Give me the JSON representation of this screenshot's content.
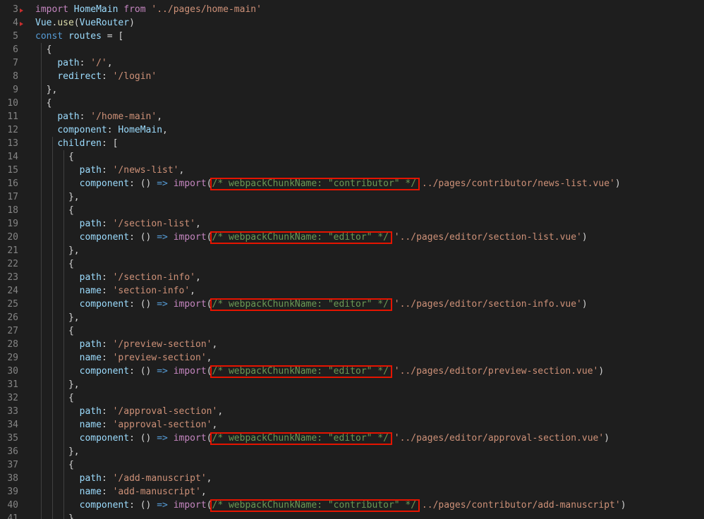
{
  "editor": {
    "lines": [
      {
        "n": "3",
        "toks": [
          [
            "ctrl",
            "import"
          ],
          [
            "punc",
            " "
          ],
          [
            "var",
            "HomeMain"
          ],
          [
            "punc",
            " "
          ],
          [
            "ctrl",
            "from"
          ],
          [
            "punc",
            " "
          ],
          [
            "str",
            "'../pages/home-main'"
          ]
        ]
      },
      {
        "n": "4",
        "toks": [
          [
            "var",
            "Vue"
          ],
          [
            "punc",
            "."
          ],
          [
            "fn",
            "use"
          ],
          [
            "punc",
            "("
          ],
          [
            "var",
            "VueRouter"
          ],
          [
            "punc",
            ")"
          ]
        ]
      },
      {
        "n": "5",
        "toks": [
          [
            "kw",
            "const"
          ],
          [
            "punc",
            " "
          ],
          [
            "var",
            "routes"
          ],
          [
            "punc",
            " = ["
          ]
        ]
      },
      {
        "n": "6",
        "toks": [
          [
            "punc",
            "  {"
          ]
        ]
      },
      {
        "n": "7",
        "toks": [
          [
            "punc",
            "    "
          ],
          [
            "var",
            "path"
          ],
          [
            "punc",
            ": "
          ],
          [
            "str",
            "'/'"
          ],
          [
            "punc",
            ","
          ]
        ]
      },
      {
        "n": "8",
        "toks": [
          [
            "punc",
            "    "
          ],
          [
            "var",
            "redirect"
          ],
          [
            "punc",
            ": "
          ],
          [
            "str",
            "'/login'"
          ]
        ]
      },
      {
        "n": "9",
        "toks": [
          [
            "punc",
            "  },"
          ]
        ]
      },
      {
        "n": "10",
        "toks": [
          [
            "punc",
            "  {"
          ]
        ]
      },
      {
        "n": "11",
        "toks": [
          [
            "punc",
            "    "
          ],
          [
            "var",
            "path"
          ],
          [
            "punc",
            ": "
          ],
          [
            "str",
            "'/home-main'"
          ],
          [
            "punc",
            ","
          ]
        ]
      },
      {
        "n": "12",
        "toks": [
          [
            "punc",
            "    "
          ],
          [
            "var",
            "component"
          ],
          [
            "punc",
            ": "
          ],
          [
            "var",
            "HomeMain"
          ],
          [
            "punc",
            ","
          ]
        ]
      },
      {
        "n": "13",
        "toks": [
          [
            "punc",
            "    "
          ],
          [
            "var",
            "children"
          ],
          [
            "punc",
            ": ["
          ]
        ]
      },
      {
        "n": "14",
        "toks": [
          [
            "punc",
            "      {"
          ]
        ]
      },
      {
        "n": "15",
        "toks": [
          [
            "punc",
            "        "
          ],
          [
            "var",
            "path"
          ],
          [
            "punc",
            ": "
          ],
          [
            "str",
            "'/news-list'"
          ],
          [
            "punc",
            ","
          ]
        ]
      },
      {
        "n": "16",
        "toks": [
          [
            "punc",
            "        "
          ],
          [
            "var",
            "component"
          ],
          [
            "punc",
            ": () "
          ],
          [
            "kw",
            "=>"
          ],
          [
            "punc",
            " "
          ],
          [
            "ctrl",
            "import"
          ],
          [
            "punc",
            "("
          ],
          [
            "cmt",
            "/* webpackChunkName: \"contributor\" */"
          ],
          [
            "str",
            "'../pages/contributor/news-list.vue'"
          ],
          [
            "punc",
            ")"
          ]
        ]
      },
      {
        "n": "17",
        "toks": [
          [
            "punc",
            "      },"
          ]
        ]
      },
      {
        "n": "18",
        "toks": [
          [
            "punc",
            "      {"
          ]
        ]
      },
      {
        "n": "19",
        "toks": [
          [
            "punc",
            "        "
          ],
          [
            "var",
            "path"
          ],
          [
            "punc",
            ": "
          ],
          [
            "str",
            "'/section-list'"
          ],
          [
            "punc",
            ","
          ]
        ]
      },
      {
        "n": "20",
        "toks": [
          [
            "punc",
            "        "
          ],
          [
            "var",
            "component"
          ],
          [
            "punc",
            ": () "
          ],
          [
            "kw",
            "=>"
          ],
          [
            "punc",
            " "
          ],
          [
            "ctrl",
            "import"
          ],
          [
            "punc",
            "("
          ],
          [
            "cmt",
            "/* webpackChunkName: \"editor\" */"
          ],
          [
            "punc",
            " "
          ],
          [
            "str",
            "'../pages/editor/section-list.vue'"
          ],
          [
            "punc",
            ")"
          ]
        ]
      },
      {
        "n": "21",
        "toks": [
          [
            "punc",
            "      },"
          ]
        ]
      },
      {
        "n": "22",
        "toks": [
          [
            "punc",
            "      {"
          ]
        ]
      },
      {
        "n": "23",
        "toks": [
          [
            "punc",
            "        "
          ],
          [
            "var",
            "path"
          ],
          [
            "punc",
            ": "
          ],
          [
            "str",
            "'/section-info'"
          ],
          [
            "punc",
            ","
          ]
        ]
      },
      {
        "n": "24",
        "toks": [
          [
            "punc",
            "        "
          ],
          [
            "var",
            "name"
          ],
          [
            "punc",
            ": "
          ],
          [
            "str",
            "'section-info'"
          ],
          [
            "punc",
            ","
          ]
        ]
      },
      {
        "n": "25",
        "toks": [
          [
            "punc",
            "        "
          ],
          [
            "var",
            "component"
          ],
          [
            "punc",
            ": () "
          ],
          [
            "kw",
            "=>"
          ],
          [
            "punc",
            " "
          ],
          [
            "ctrl",
            "import"
          ],
          [
            "punc",
            "("
          ],
          [
            "cmt",
            "/* webpackChunkName: \"editor\" */"
          ],
          [
            "punc",
            " "
          ],
          [
            "str",
            "'../pages/editor/section-info.vue'"
          ],
          [
            "punc",
            ")"
          ]
        ]
      },
      {
        "n": "26",
        "toks": [
          [
            "punc",
            "      },"
          ]
        ]
      },
      {
        "n": "27",
        "toks": [
          [
            "punc",
            "      {"
          ]
        ]
      },
      {
        "n": "28",
        "toks": [
          [
            "punc",
            "        "
          ],
          [
            "var",
            "path"
          ],
          [
            "punc",
            ": "
          ],
          [
            "str",
            "'/preview-section'"
          ],
          [
            "punc",
            ","
          ]
        ]
      },
      {
        "n": "29",
        "toks": [
          [
            "punc",
            "        "
          ],
          [
            "var",
            "name"
          ],
          [
            "punc",
            ": "
          ],
          [
            "str",
            "'preview-section'"
          ],
          [
            "punc",
            ","
          ]
        ]
      },
      {
        "n": "30",
        "toks": [
          [
            "punc",
            "        "
          ],
          [
            "var",
            "component"
          ],
          [
            "punc",
            ": () "
          ],
          [
            "kw",
            "=>"
          ],
          [
            "punc",
            " "
          ],
          [
            "ctrl",
            "import"
          ],
          [
            "punc",
            "("
          ],
          [
            "cmt",
            "/* webpackChunkName: \"editor\" */"
          ],
          [
            "punc",
            " "
          ],
          [
            "str",
            "'../pages/editor/preview-section.vue'"
          ],
          [
            "punc",
            ")"
          ]
        ]
      },
      {
        "n": "31",
        "toks": [
          [
            "punc",
            "      },"
          ]
        ]
      },
      {
        "n": "32",
        "toks": [
          [
            "punc",
            "      {"
          ]
        ]
      },
      {
        "n": "33",
        "toks": [
          [
            "punc",
            "        "
          ],
          [
            "var",
            "path"
          ],
          [
            "punc",
            ": "
          ],
          [
            "str",
            "'/approval-section'"
          ],
          [
            "punc",
            ","
          ]
        ]
      },
      {
        "n": "34",
        "toks": [
          [
            "punc",
            "        "
          ],
          [
            "var",
            "name"
          ],
          [
            "punc",
            ": "
          ],
          [
            "str",
            "'approval-section'"
          ],
          [
            "punc",
            ","
          ]
        ]
      },
      {
        "n": "35",
        "toks": [
          [
            "punc",
            "        "
          ],
          [
            "var",
            "component"
          ],
          [
            "punc",
            ": () "
          ],
          [
            "kw",
            "=>"
          ],
          [
            "punc",
            " "
          ],
          [
            "ctrl",
            "import"
          ],
          [
            "punc",
            "("
          ],
          [
            "cmt",
            "/* webpackChunkName: \"editor\" */"
          ],
          [
            "punc",
            " "
          ],
          [
            "str",
            "'../pages/editor/approval-section.vue'"
          ],
          [
            "punc",
            ")"
          ]
        ]
      },
      {
        "n": "36",
        "toks": [
          [
            "punc",
            "      },"
          ]
        ]
      },
      {
        "n": "37",
        "toks": [
          [
            "punc",
            "      {"
          ]
        ]
      },
      {
        "n": "38",
        "toks": [
          [
            "punc",
            "        "
          ],
          [
            "var",
            "path"
          ],
          [
            "punc",
            ": "
          ],
          [
            "str",
            "'/add-manuscript'"
          ],
          [
            "punc",
            ","
          ]
        ]
      },
      {
        "n": "39",
        "toks": [
          [
            "punc",
            "        "
          ],
          [
            "var",
            "name"
          ],
          [
            "punc",
            ": "
          ],
          [
            "str",
            "'add-manuscript'"
          ],
          [
            "punc",
            ","
          ]
        ]
      },
      {
        "n": "40",
        "toks": [
          [
            "punc",
            "        "
          ],
          [
            "var",
            "component"
          ],
          [
            "punc",
            ": () "
          ],
          [
            "kw",
            "=>"
          ],
          [
            "punc",
            " "
          ],
          [
            "ctrl",
            "import"
          ],
          [
            "punc",
            "("
          ],
          [
            "cmt",
            "/* webpackChunkName: \"contributor\" */"
          ],
          [
            "str",
            "'../pages/contributor/add-manuscript'"
          ],
          [
            "punc",
            ")"
          ]
        ]
      },
      {
        "n": "41",
        "toks": [
          [
            "punc",
            "      }"
          ]
        ]
      }
    ],
    "highlighted_lines": [
      "16",
      "20",
      "25",
      "30",
      "35",
      "40"
    ],
    "colors": {
      "background": "#1e1e1e",
      "line_number": "#858585",
      "keyword": "#569cd6",
      "control": "#c586c0",
      "string": "#ce9178",
      "variable": "#9cdcfe",
      "function": "#dcdcaa",
      "comment": "#6a9955",
      "highlight_box": "#e51400"
    }
  }
}
